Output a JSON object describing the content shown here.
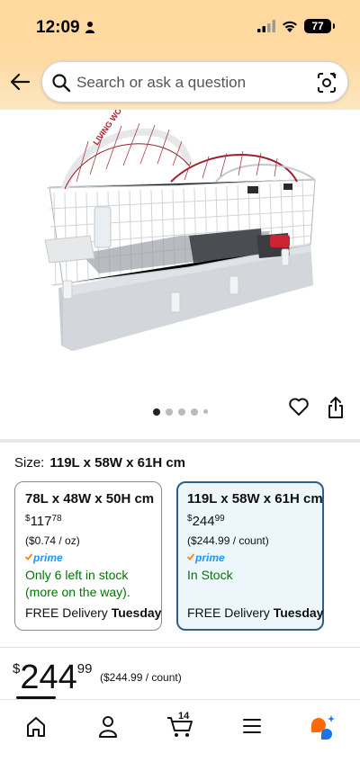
{
  "status_bar": {
    "time": "12:09",
    "battery": "77"
  },
  "search": {
    "placeholder": "Search or ask a question"
  },
  "product_image": {
    "brand_text": "LIVING WORLD",
    "carousel_total": 5,
    "carousel_active": 1
  },
  "size": {
    "label": "Size:",
    "selected": "119L x 58W x 61H cm"
  },
  "options": [
    {
      "title": "78L x 48W x 50H cm",
      "currency": "$",
      "price_whole": "117",
      "price_cents": "78",
      "unit_price": "($0.74 / oz)",
      "prime": "prime",
      "stock_line1": "Only 6 left in stock",
      "stock_line2": "(more on the way).",
      "delivery_prefix": "FREE Delivery",
      "delivery_day": "Tuesday"
    },
    {
      "title": "119L x 58W x 61H cm",
      "currency": "$",
      "price_whole": "244",
      "price_cents": "99",
      "unit_price": "($244.99 / count)",
      "prime": "prime",
      "stock_line1": "In Stock",
      "delivery_prefix": "FREE Delivery",
      "delivery_day": "Tuesday"
    }
  ],
  "price": {
    "currency": "$",
    "whole": "244",
    "cents": "99",
    "unit": "($244.99 / count)"
  },
  "bottom_nav": {
    "cart_count": "14"
  },
  "colors": {
    "header": "#ffd9a0",
    "selected_border": "#2e5e8a",
    "selected_bg": "#edf7fb",
    "stock_green": "#007600",
    "prime_blue": "#1a98ff"
  }
}
